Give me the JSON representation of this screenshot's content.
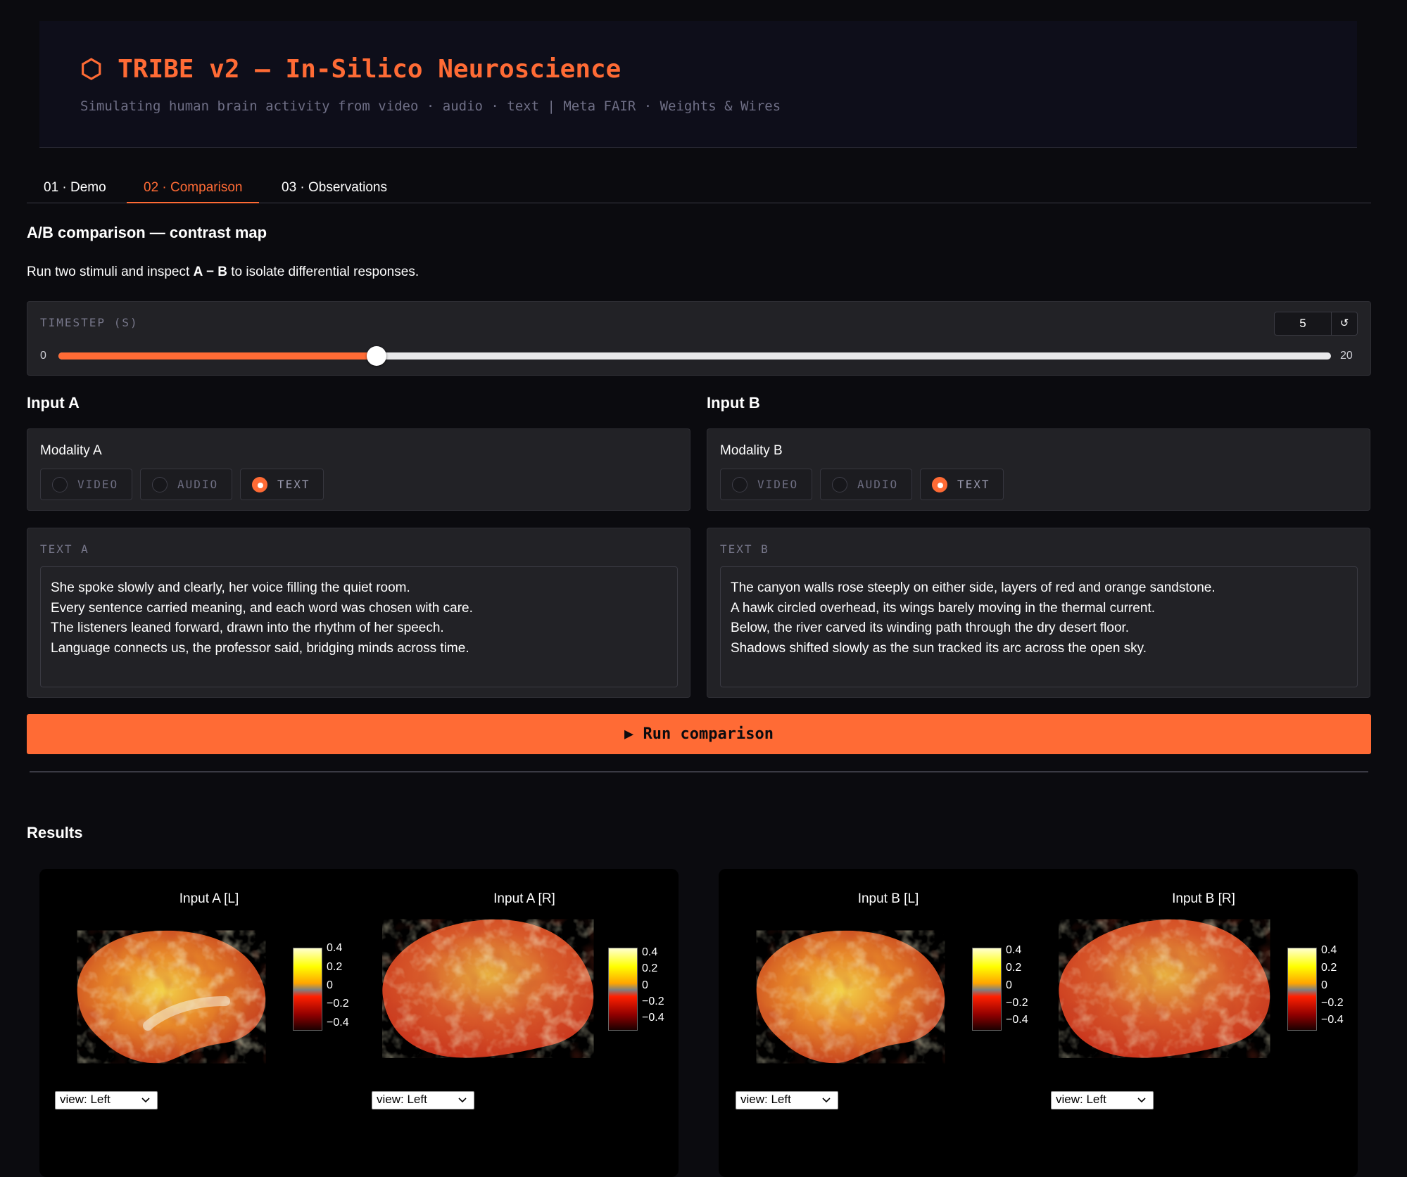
{
  "header": {
    "title": "⬡ TRIBE v2 — In-Silico Neuroscience",
    "subtitle": "Simulating human brain activity from video · audio · text | Meta FAIR · Weights & Wires"
  },
  "tabs": [
    {
      "label": "01 · Demo",
      "active": false
    },
    {
      "label": "02 · Comparison",
      "active": true
    },
    {
      "label": "03 · Observations",
      "active": false
    }
  ],
  "comparison": {
    "title": "A/B comparison — contrast map",
    "desc_prefix": "Run two stimuli and inspect ",
    "desc_bold": "A − B",
    "desc_suffix": " to isolate differential responses."
  },
  "timestep": {
    "label": "TIMESTEP (S)",
    "value": "5",
    "reset_icon": "↺",
    "min": "0",
    "max": "20",
    "fraction": 0.25
  },
  "input_a": {
    "heading": "Input A",
    "modality_label": "Modality A",
    "options": [
      "VIDEO",
      "AUDIO",
      "TEXT"
    ],
    "selected": "TEXT",
    "text_label": "TEXT A",
    "text": "She spoke slowly and clearly, her voice filling the quiet room.\nEvery sentence carried meaning, and each word was chosen with care.\nThe listeners leaned forward, drawn into the rhythm of her speech.\nLanguage connects us, the professor said, bridging minds across time."
  },
  "input_b": {
    "heading": "Input B",
    "modality_label": "Modality B",
    "options": [
      "VIDEO",
      "AUDIO",
      "TEXT"
    ],
    "selected": "TEXT",
    "text_label": "TEXT B",
    "text": "The canyon walls rose steeply on either side, layers of red and orange sandstone.\nA hawk circled overhead, its wings barely moving in the thermal current.\nBelow, the river carved its winding path through the dry desert floor.\nShadows shifted slowly as the sun tracked its arc across the open sky."
  },
  "run_button": "▶ Run comparison",
  "results": {
    "title": "Results",
    "views": [
      {
        "title": "Input A [L]",
        "select": "view: Left"
      },
      {
        "title": "Input A [R]",
        "select": "view: Left"
      },
      {
        "title": "Input B [L]",
        "select": "view: Left"
      },
      {
        "title": "Input B [R]",
        "select": "view: Left"
      }
    ],
    "colorbar_ticks": [
      "0.4",
      "0.2",
      "0",
      "−0.2",
      "−0.4"
    ]
  },
  "colors": {
    "accent": "#ff6b35",
    "background": "#0b0b0f",
    "panel": "#222226"
  },
  "icons": {
    "reset": "reset-icon",
    "select": "chevron-down-icon",
    "play": "play-icon"
  }
}
